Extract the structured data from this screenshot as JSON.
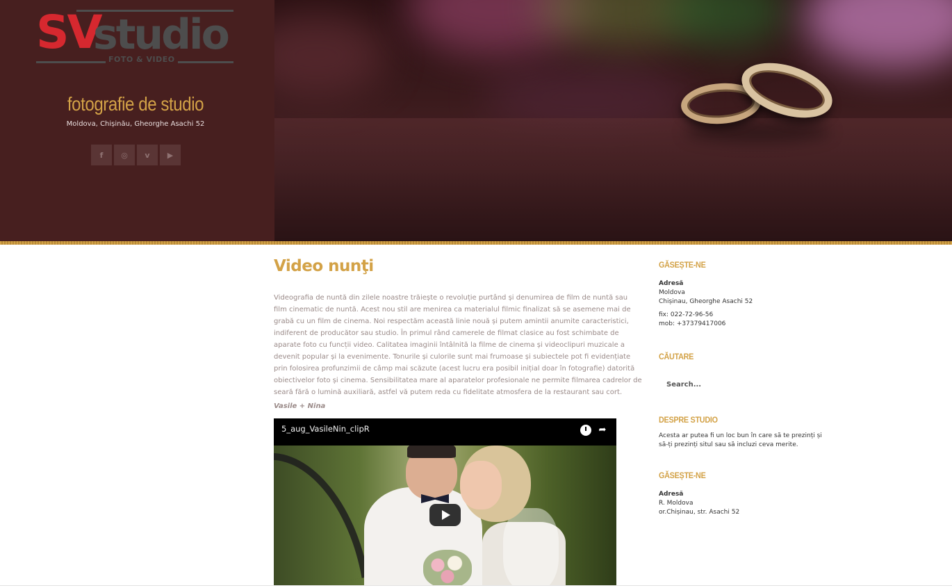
{
  "brand": {
    "logo_text_red": "SV",
    "logo_text_grey": "studio",
    "logo_subtitle": "FOTO & VIDEO",
    "site_title": "fotografie de studio",
    "address": "Moldova, Chișinău, Gheorghe Asachi 52",
    "colors": {
      "panel": "#471f1f",
      "accent": "#d3a247",
      "logo_red": "#d6282f"
    }
  },
  "social": [
    {
      "icon": "facebook-icon",
      "glyph": "f"
    },
    {
      "icon": "instagram-icon",
      "glyph": "◎"
    },
    {
      "icon": "vimeo-icon",
      "glyph": "v"
    },
    {
      "icon": "youtube-icon",
      "glyph": "▶"
    }
  ],
  "main": {
    "title": "Video nunţi",
    "body": "Videografia de nuntă din zilele noastre trăiește o revoluție purtând și denumirea de film de nuntă sau film cinematic de nuntă. Acest nou stil are menirea ca materialul filmic finalizat să se asemene mai de grabă cu un film de cinema. Noi respectăm această linie nouă și putem amintii anumite caracteristici, indiferent de producător sau studio. În primul rând camerele de filmat clasice au fost schimbate de aparate foto cu funcții video. Calitatea imaginii întâlnită la filme de cinema și videoclipuri muzicale a devenit popular și la evenimente. Tonurile și culorile sunt mai frumoase și subiectele pot fi evidențiate prin folosirea profunzimii de câmp mai scăzute (acest lucru era posibil inițial doar în fotografie) datorită obiectivelor foto și cinema. Sensibilitatea mare al aparatelor profesionale ne permite filmarea cadrelor de seară fără o lumină auxiliară, astfel vă putem reda cu fidelitate atmosfera de la restaurant sau cort.",
    "caption": "Vasile + Nina",
    "video": {
      "title": "5_aug_VasileNin_clipR"
    }
  },
  "sidebar": {
    "find_us": {
      "title": "GĂSEȘTE-NE",
      "address_label": "Adresă",
      "address_line1": "Moldova",
      "address_line2": "Chișinau, Gheorghe Asachi 52",
      "phone_fix": "fix: 022-72-96-56",
      "phone_mob": "mob: +37379417006"
    },
    "search": {
      "title": "CĂUTARE",
      "placeholder": "Search..."
    },
    "about": {
      "title": "DESPRE STUDIO",
      "text": "Acesta ar putea fi un loc bun în care să te prezinți și să-ți prezinți situl sau să incluzi ceva merite."
    },
    "find_us_2": {
      "title": "GĂSEȘTE-NE",
      "address_label": "Adresă",
      "address_line1": "R. Moldova",
      "address_line2": "or.Chișinau, str. Asachi 52"
    }
  }
}
